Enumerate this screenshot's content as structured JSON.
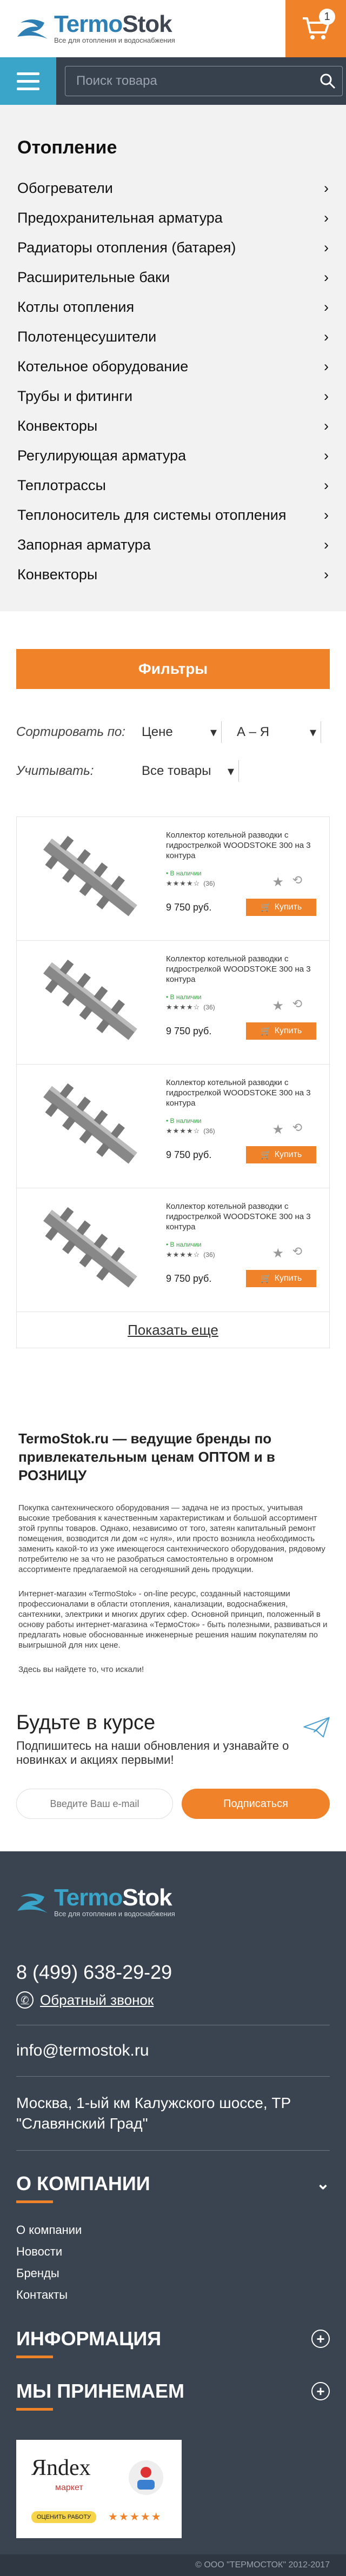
{
  "brand": {
    "name_a": "Termo",
    "name_b": "Stok",
    "tagline": "Все для отопления и водоснабжения"
  },
  "cart": {
    "count": "1"
  },
  "search": {
    "placeholder": "Поиск товара"
  },
  "categories": {
    "title": "Отопление",
    "items": [
      {
        "label": "Обогреватели"
      },
      {
        "label": "Предохранительная арматура"
      },
      {
        "label": "Радиаторы отопления (батарея)"
      },
      {
        "label": "Расширительные баки"
      },
      {
        "label": "Котлы отопления"
      },
      {
        "label": "Полотенцесушители"
      },
      {
        "label": "Котельное оборудование"
      },
      {
        "label": "Трубы и фитинги"
      },
      {
        "label": "Конвекторы"
      },
      {
        "label": "Регулирующая арматура"
      },
      {
        "label": "Теплотрассы"
      },
      {
        "label": "Теплоноситель для системы отопления"
      },
      {
        "label": "Запорная арматура"
      },
      {
        "label": "Конвекторы"
      }
    ]
  },
  "filters": {
    "button_label": "Фильтры",
    "sort_label": "Сортировать по:",
    "sort_value": "Цене",
    "order_value": "А – Я",
    "consider_label": "Учитывать:",
    "consider_value": "Все товары"
  },
  "products": [
    {
      "name": "Коллектор котельной разводки с гидрострелкой WOODSTOKE 300 на 3 контура",
      "stock": "• В наличии",
      "reviews": "(36)",
      "rating": 4,
      "price": "9 750 руб.",
      "buy_label": "Купить"
    },
    {
      "name": "Коллектор котельной разводки с гидрострелкой WOODSTOKE 300 на 3 контура",
      "stock": "• В наличии",
      "reviews": "(36)",
      "rating": 4,
      "price": "9 750 руб.",
      "buy_label": "Купить"
    },
    {
      "name": "Коллектор котельной разводки с гидрострелкой WOODSTOKE 300 на 3 контура",
      "stock": "• В наличии",
      "reviews": "(36)",
      "rating": 4,
      "price": "9 750 руб.",
      "buy_label": "Купить"
    },
    {
      "name": "Коллектор котельной разводки с гидрострелкой WOODSTOKE 300 на 3 контура",
      "stock": "• В наличии",
      "reviews": "(36)",
      "rating": 4,
      "price": "9 750 руб.",
      "buy_label": "Купить"
    }
  ],
  "more_label": "Показать еще",
  "about": {
    "heading": "TermoStok.ru — ведущие бренды по привлекательным ценам ОПТОМ и в РОЗНИЦУ",
    "p1": "Покупка сантехнического оборудования — задача не из простых, учитывая высокие требования к качественным характеристикам и большой ассортимент этой группы товаров. Однако, независимо от того, затеян капитальный ремонт помещения, возводится ли дом «с нуля», или просто возникла необходимость заменить какой-то из уже имеющегося сантехнического оборудования, рядовому потребителю не за что не разобраться самостоятельно в огромном ассортименте предлагаемой на сегодняшний день продукции.",
    "p2": "Интернет-магазин «TermoStok» - on-line ресурс, созданный настоящими профессионалами в области отопления, канализации, водоснабжения, сантехники, электрики и многих других сфер. Основной принцип, положенный в основу работы интернет-магазина «ТермоСток» - быть полезными, развиваться и предлагать новые обоснованные инженерные решения нашим покупателям по выигрышной для них цене.",
    "p3": "Здесь вы найдете то, что искали!"
  },
  "subscribe": {
    "title": "Будьте в курсе",
    "text": "Подпишитесь на наши обновления и узнавайте о новинках и акциях первыми!",
    "placeholder": "Введите Ваш e-mail",
    "button_label": "Подписаться"
  },
  "footer": {
    "phone": "8 (499) 638-29-29",
    "callback_label": "Обратный звонок",
    "email": "info@termostok.ru",
    "address": "Москва, 1-ый км Калужского шоссе, ТР \"Славянский Град\"",
    "company_title": "О КОМПАНИИ",
    "company_links": [
      {
        "label": "О компании"
      },
      {
        "label": "Новости"
      },
      {
        "label": "Бренды"
      },
      {
        "label": "Контакты"
      }
    ],
    "info_title": "ИНФОРМАЦИЯ",
    "accept_title": "МЫ ПРИНЕМАЕМ",
    "yandex": {
      "logo": "Яndex",
      "market": "маркет",
      "cta": "ОЦЕНИТЬ РАБОТУ"
    },
    "copyright": "© ООО \"ТЕРМОСТОК\" 2012-2017"
  },
  "colors": {
    "accent": "#f0822a",
    "dark": "#37414d",
    "teal": "#3aa5c9",
    "brand_blue": "#2e7fb4",
    "stock_green": "#3aa547"
  },
  "icons": [
    "cart-icon",
    "menu-icon",
    "search-icon",
    "chevron-right-icon",
    "chevron-down-icon",
    "star-icon",
    "compare-icon",
    "cart-small-icon",
    "paper-plane-icon",
    "phone-icon",
    "plus-icon"
  ]
}
